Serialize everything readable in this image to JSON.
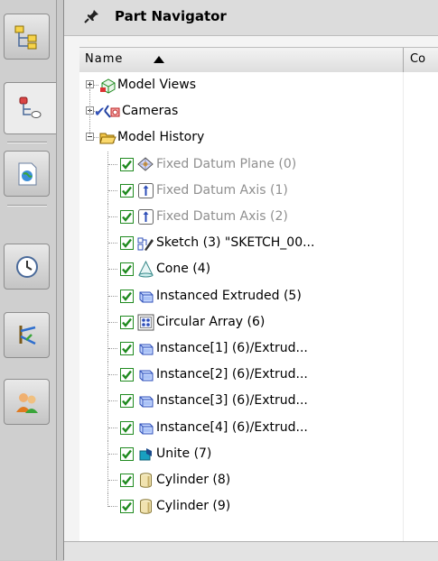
{
  "panel": {
    "title": "Part Navigator"
  },
  "columns": {
    "name": "Name",
    "second": "Co"
  },
  "tree": [
    {
      "label": "Model Views",
      "icon": "model-views-icon",
      "type": "group",
      "expander": "plus"
    },
    {
      "label": "Cameras",
      "icon": "cameras-icon",
      "type": "group",
      "expander": "plus"
    },
    {
      "label": "Model History",
      "icon": "open-folder-icon",
      "type": "group",
      "expander": "minus"
    },
    {
      "label": "Fixed Datum Plane (0)",
      "icon": "datum-plane-icon",
      "type": "feature",
      "state": "inactive"
    },
    {
      "label": "Fixed Datum Axis (1)",
      "icon": "datum-axis-icon",
      "type": "feature",
      "state": "inactive"
    },
    {
      "label": "Fixed Datum Axis (2)",
      "icon": "datum-axis-icon",
      "type": "feature",
      "state": "inactive"
    },
    {
      "label": "Sketch (3) \"SKETCH_00...",
      "icon": "sketch-icon",
      "type": "feature",
      "state": "active"
    },
    {
      "label": "Cone (4)",
      "icon": "cone-icon",
      "type": "feature",
      "state": "active"
    },
    {
      "label": "Instanced Extruded (5)",
      "icon": "extrude-icon",
      "type": "feature",
      "state": "active"
    },
    {
      "label": "Circular Array (6)",
      "icon": "circular-array-icon",
      "type": "feature",
      "state": "active"
    },
    {
      "label": "Instance[1] (6)/Extrud...",
      "icon": "extrude-icon",
      "type": "feature",
      "state": "active"
    },
    {
      "label": "Instance[2] (6)/Extrud...",
      "icon": "extrude-icon",
      "type": "feature",
      "state": "active"
    },
    {
      "label": "Instance[3] (6)/Extrud...",
      "icon": "extrude-icon",
      "type": "feature",
      "state": "active"
    },
    {
      "label": "Instance[4] (6)/Extrud...",
      "icon": "extrude-icon",
      "type": "feature",
      "state": "active"
    },
    {
      "label": "Unite (7)",
      "icon": "unite-icon",
      "type": "feature",
      "state": "active"
    },
    {
      "label": "Cylinder (8)",
      "icon": "cylinder-icon",
      "type": "feature",
      "state": "active"
    },
    {
      "label": "Cylinder (9)",
      "icon": "cylinder-icon",
      "type": "feature",
      "state": "active"
    }
  ],
  "rail": [
    {
      "icon": "assembly-navigator-icon",
      "active": false
    },
    {
      "icon": "part-navigator-icon",
      "active": true
    },
    {
      "icon": "web-browser-icon",
      "active": false
    },
    {
      "icon": "history-clock-icon",
      "active": false
    },
    {
      "icon": "system-materials-icon",
      "active": false
    },
    {
      "icon": "roles-icon",
      "active": false
    }
  ],
  "colors": {
    "check": "#1f8a1f",
    "inactive_text": "#8f8f8f",
    "accent": "#2f6fce"
  }
}
